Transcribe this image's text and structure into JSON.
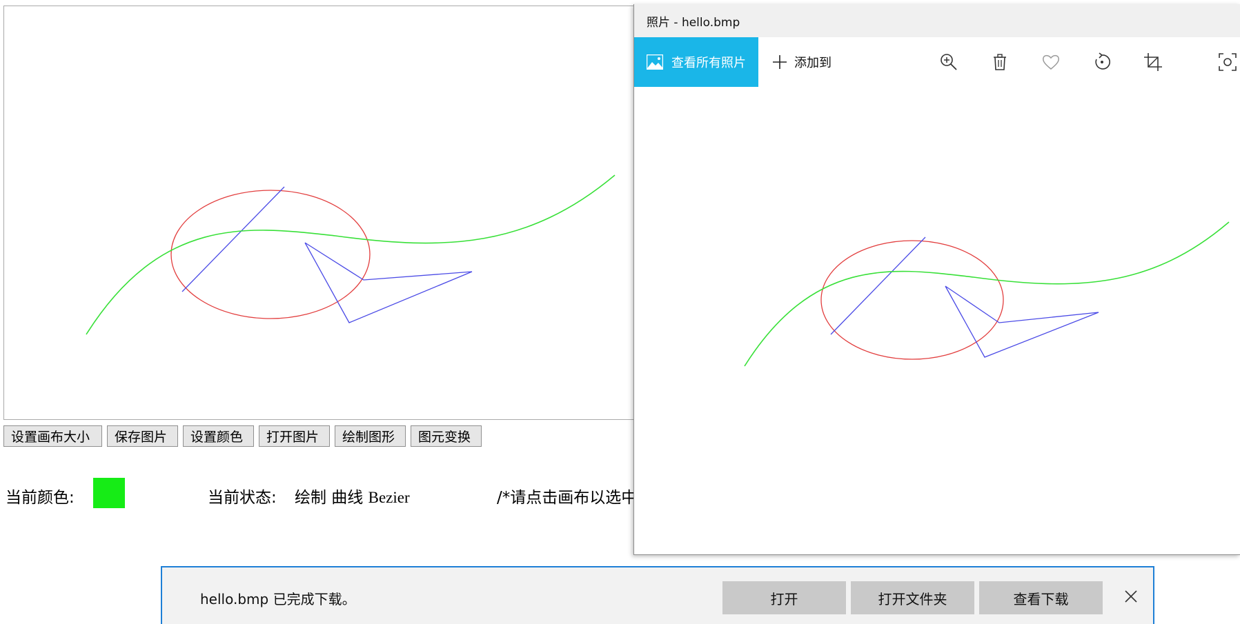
{
  "toolbar": {
    "buttons": [
      "设置画布大小",
      "保存图片",
      "设置颜色",
      "打开图片",
      "绘制图形",
      "图元变换"
    ]
  },
  "status": {
    "color_label": "当前颜色:",
    "current_color": "#16ec16",
    "state_label": "当前状态:",
    "state_value_cn": "绘制 曲线",
    "state_value_latin": "Bezier",
    "hint": "/*请点击画布以选中"
  },
  "drawing_colors": {
    "ellipse": "#e23d3d",
    "lines": "#4a4ae6",
    "curve": "#38e038"
  },
  "photos": {
    "title": "照片 - hello.bmp",
    "view_all_label": "查看所有照片",
    "add_to_label": "添加到",
    "accent_color": "#1ab6e8",
    "icons": [
      "zoom-in-icon",
      "delete-icon",
      "heart-icon",
      "rotate-icon",
      "crop-icon",
      "edit-icon"
    ]
  },
  "download": {
    "message": "hello.bmp 已完成下载。",
    "open_label": "打开",
    "open_folder_label": "打开文件夹",
    "view_downloads_label": "查看下载"
  }
}
